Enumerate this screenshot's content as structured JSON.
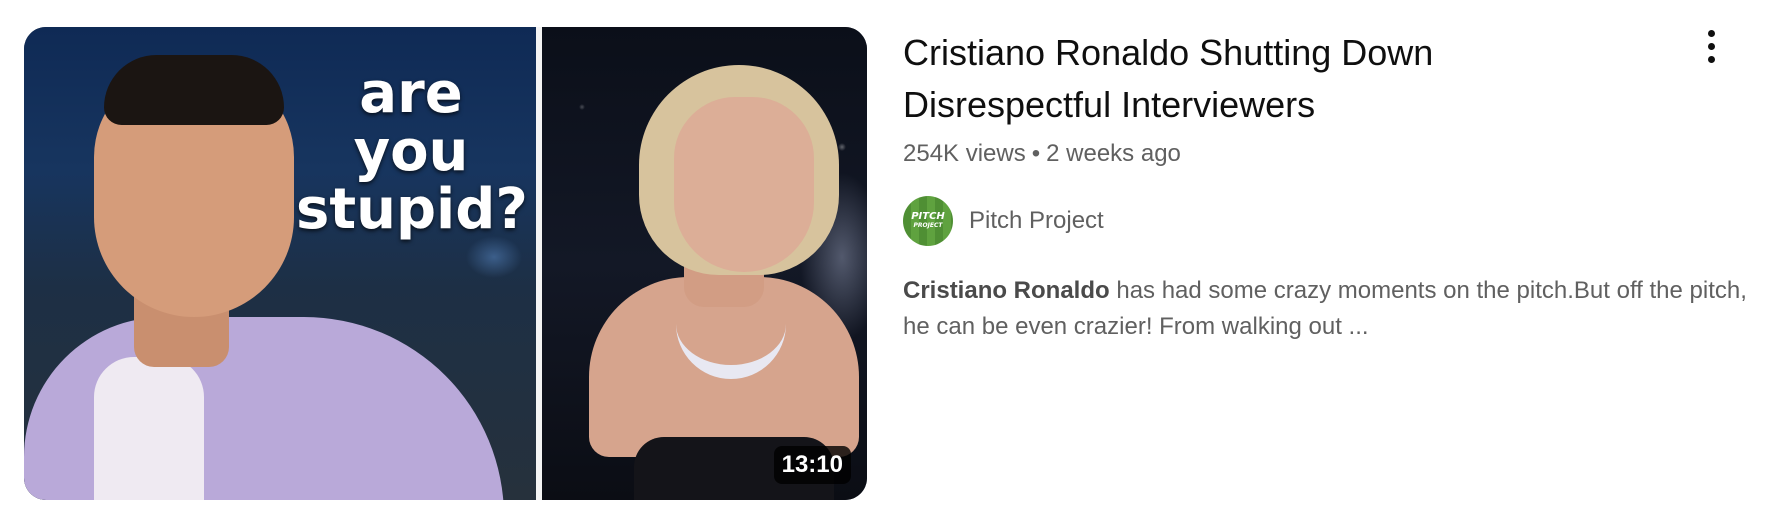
{
  "video": {
    "thumbnail": {
      "caption": "are you\nstupid?",
      "duration": "13:10"
    },
    "title": "Cristiano Ronaldo Shutting Down Disrespectful Interviewers",
    "views": "254K views",
    "separator": "•",
    "age": "2 weeks ago",
    "channel": {
      "name": "Pitch Project",
      "avatar_text_line1": "PITCH",
      "avatar_text_line2": "PROJECT"
    },
    "description": {
      "highlight": "Cristiano Ronaldo",
      "rest": " has had some crazy moments on the pitch.But off the pitch, he can be even crazier! From walking out ..."
    },
    "menu_icon": "more-vertical-icon"
  },
  "colors": {
    "title": "#0f0f0f",
    "secondary_text": "#606060",
    "avatar_green": "#5fa23f",
    "duration_bg": "#000000"
  }
}
